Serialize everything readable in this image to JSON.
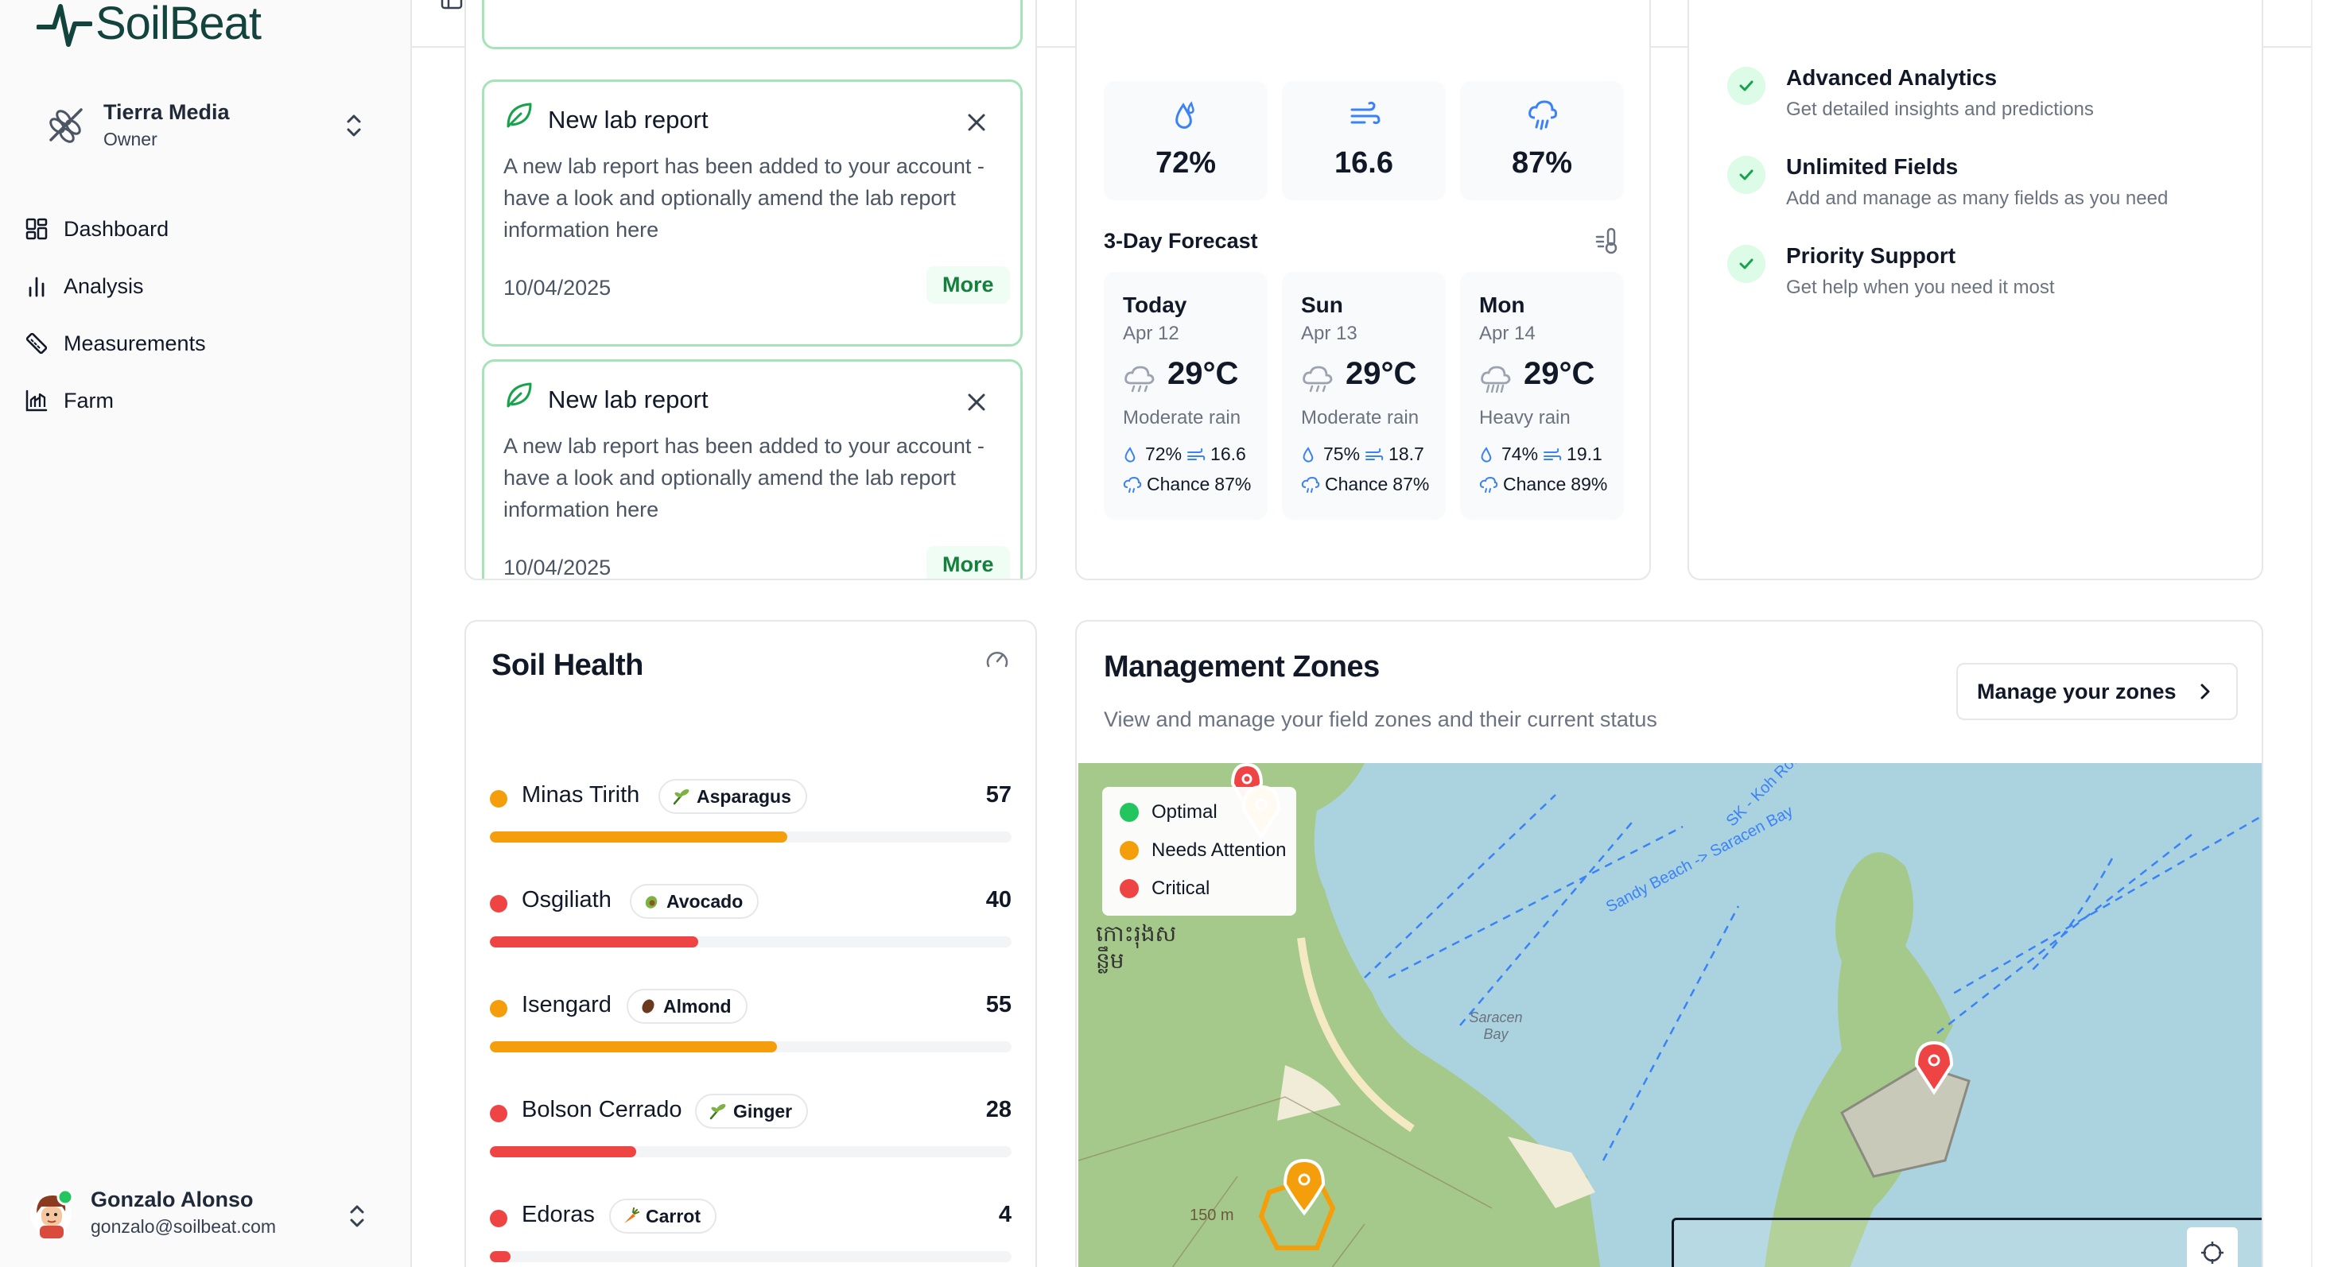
{
  "app": {
    "name": "SoilBeat"
  },
  "team": {
    "name": "Tierra Media",
    "role": "Owner"
  },
  "nav": [
    {
      "label": "Dashboard",
      "icon": "dashboard-icon"
    },
    {
      "label": "Analysis",
      "icon": "bar-chart-icon"
    },
    {
      "label": "Measurements",
      "icon": "ruler-icon"
    },
    {
      "label": "Farm",
      "icon": "farm-chart-icon"
    }
  ],
  "user": {
    "name": "Gonzalo Alonso",
    "email": "gonzalo@soilbeat.com"
  },
  "notifications": [
    {
      "title": "New lab report",
      "body": "A new lab report has been added to your account - have a look and optionally amend the lab report information here",
      "date": "10/04/2025",
      "action": "More"
    },
    {
      "title": "New lab report",
      "body": "A new lab report has been added to your account - have a look and optionally amend the lab report information here",
      "date": "10/04/2025",
      "action": "More"
    }
  ],
  "weather": {
    "current": [
      {
        "icon": "humidity-icon",
        "value": "72%"
      },
      {
        "icon": "wind-icon",
        "value": "16.6"
      },
      {
        "icon": "rain-chance-icon",
        "value": "87%"
      }
    ],
    "forecast_title": "3-Day Forecast",
    "forecast": [
      {
        "day": "Today",
        "date": "Apr 12",
        "temp": "29°C",
        "desc": "Moderate rain",
        "humidity": "72%",
        "wind": "16.6",
        "chance_label": "Chance",
        "chance": "87%"
      },
      {
        "day": "Sun",
        "date": "Apr 13",
        "temp": "29°C",
        "desc": "Moderate rain",
        "humidity": "75%",
        "wind": "18.7",
        "chance_label": "Chance",
        "chance": "87%"
      },
      {
        "day": "Mon",
        "date": "Apr 14",
        "temp": "29°C",
        "desc": "Heavy rain",
        "humidity": "74%",
        "wind": "19.1",
        "chance_label": "Chance",
        "chance": "89%"
      }
    ]
  },
  "features": [
    {
      "title": "Advanced Analytics",
      "desc": "Get detailed insights and predictions"
    },
    {
      "title": "Unlimited Fields",
      "desc": "Add and manage as many fields as you need"
    },
    {
      "title": "Priority Support",
      "desc": "Get help when you need it most"
    }
  ],
  "soil_health": {
    "title": "Soil Health",
    "fields": [
      {
        "name": "Minas Tirith",
        "crop": "Asparagus",
        "crop_icon": "sprout-icon",
        "score": "57",
        "level": 0.57,
        "status": "warning"
      },
      {
        "name": "Osgiliath",
        "crop": "Avocado",
        "crop_icon": "avocado-icon",
        "score": "40",
        "level": 0.4,
        "status": "critical"
      },
      {
        "name": "Isengard",
        "crop": "Almond",
        "crop_icon": "almond-icon",
        "score": "55",
        "level": 0.55,
        "status": "warning"
      },
      {
        "name": "Bolson Cerrado",
        "crop": "Ginger",
        "crop_icon": "sprout-icon",
        "score": "28",
        "level": 0.28,
        "status": "critical"
      },
      {
        "name": "Edoras",
        "crop": "Carrot",
        "crop_icon": "carrot-icon",
        "score": "4",
        "level": 0.04,
        "status": "critical"
      }
    ]
  },
  "zones": {
    "title": "Management Zones",
    "subtitle": "View and manage your field zones and their current status",
    "manage_label": "Manage your zones",
    "legend": [
      "Optimal",
      "Needs Attention",
      "Critical"
    ],
    "map_labels": {
      "khmer": "កោះរុងស ន្លឹម",
      "bay": "Saracen Bay",
      "route": "Sandy Beach -> Saracen Bay",
      "route2": "SK - Koh Ro...",
      "elevation": "150 m"
    }
  },
  "colors": {
    "optimal": "#22c55e",
    "warning": "#f59e0b",
    "critical": "#ef4444",
    "brand": "#12433d"
  }
}
